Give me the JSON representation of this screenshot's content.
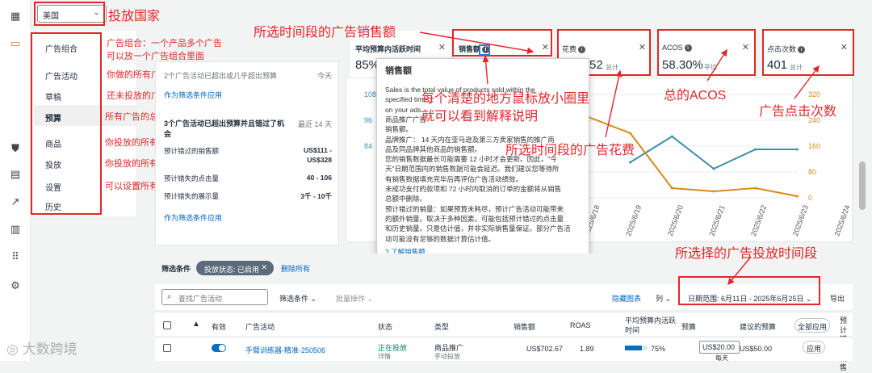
{
  "country": {
    "value": "美国"
  },
  "menu": [
    {
      "label": "广告组合"
    },
    {
      "label": "广告活动"
    },
    {
      "label": "草稿"
    },
    {
      "label": "预算"
    },
    {
      "label": "商品"
    },
    {
      "label": "投放"
    },
    {
      "label": "设置"
    },
    {
      "label": "历史"
    }
  ],
  "notices": {
    "item1": "2个广告活动已超出或几乎超出预算",
    "item1_time": "今天",
    "item1_link": "作为筛选条件应用",
    "item2_title": "3个广告活动已超出预算并且错过了机会",
    "item2_time": "最近 14 天",
    "rows": [
      {
        "label": "预计错过的销售额",
        "value": "US$111 - US$328"
      },
      {
        "label": "预计错失的点击量",
        "value": "40 - 106"
      },
      {
        "label": "预计错失的展示量",
        "value": "3千 - 10千"
      }
    ],
    "apply_link": "作为筛选条件应用"
  },
  "metrics": {
    "m1_label": "平均预算内活跃时间",
    "m1_value": "85%",
    "m2_label": "销售额",
    "m3_label": "花费",
    "m3_value": "52",
    "m3_sub": "总计",
    "m4_label": "ACOS",
    "m4_value": "58.30%",
    "m4_sub": "平均",
    "m5_label": "点击次数",
    "m5_value": "401",
    "m5_sub": "总计"
  },
  "tooltip": {
    "title": "销售额",
    "lines": [
      "Sales is the total value of products sold within the",
      "specified time",
      "on your ads.",
      "商品推广广告",
      "销售额。",
      "品牌推广： 14 天内在亚马逊及第三方卖家销售的推广商",
      "品及同品牌其他商品的销售额。",
      "您的销售数据最长可能需要 12 小时才会更新。因此，\"今",
      "天\"日期范围内的销售数据可能会延迟。我们建议您等待所",
      "有销售数据填充完毕后再评估广告活动绩效。",
      "未成功支付的款项和 72 小时内取消的订单的金额将从销售",
      "总额中删除。",
      "预计错过的销量：如果预算未耗尽，预计广告活动可能带来",
      "的额外销量。取决于多种因素，可能包括预计错过的点击量",
      "和历史销量。只是估计值，并非实际销售量保证。部分广告活",
      "动可能没有足够的数据计算估计值。"
    ],
    "link": "了解销售额"
  },
  "chart_data": {
    "type": "line",
    "x": [
      "2025/6/18",
      "2025/6/19",
      "2025/6/20",
      "2025/6/21",
      "2025/6/22",
      "2025/6/23",
      "2025/6/24"
    ],
    "y_left_ticks": [
      "108",
      "96",
      "84"
    ],
    "y_right_ticks": [
      "320",
      "240",
      "160",
      "80",
      "0"
    ],
    "series": [
      {
        "values": [
          110,
          190,
          90,
          150,
          150
        ],
        "color": "#3b8fad"
      },
      {
        "values": [
          250,
          200,
          30,
          20,
          30,
          5
        ],
        "color": "#d98a1a"
      }
    ]
  },
  "filters": {
    "label": "筛选条件",
    "chip": "投放状态: 已启用",
    "delete_all": "删除所有",
    "search_placeholder": "查找广告活动",
    "filter_btn": "筛选条件",
    "bulk": "批量操作",
    "hide_chart": "隐藏图表",
    "columns": "列",
    "date_range": "日期范围: 6月11日 - 2025年6月25日",
    "export": "导出"
  },
  "table": {
    "headers": [
      "有效",
      "广告活动",
      "状态",
      "类型",
      "销售额",
      "ROAS",
      "平均预算内活跃时间",
      "预算",
      "建议的预算",
      "全部应用",
      "预计错过销售"
    ],
    "row": {
      "name": "手臂训练器-精准-250506",
      "status": "正在投放",
      "status_sub": "详情",
      "type": "商品推广",
      "type_sub": "手动投放",
      "sales": "US$702.67",
      "roas": "1.89",
      "active": "75%",
      "budget": "US$20.00",
      "budget_sub": "每天",
      "suggested": "US$50.00",
      "apply": "应用"
    }
  },
  "annotations": {
    "a1": "投放国家",
    "a2": "广告组合：一个产品多个广告",
    "a2b": "可以放一个广告组合里面",
    "a3": "你做的所有广告活动",
    "a4": "还未投放的广告活动",
    "a5": "所有广告的总预算烧的情况",
    "a6": "你投放的所有商品",
    "a7": "你投放的所有关键词",
    "a8": "可以设置所有广告的总预算",
    "a9": "所选时间段的广告销售额",
    "a10": "每个清楚的地方鼠标放小圈里",
    "a10b": "就可以看到解释说明",
    "a11": "所选时间段的广告花费",
    "a12": "总的ACOS",
    "a13": "广告点击次数",
    "a14": "所选择的广告投放时间段"
  },
  "watermark": "大数跨境"
}
